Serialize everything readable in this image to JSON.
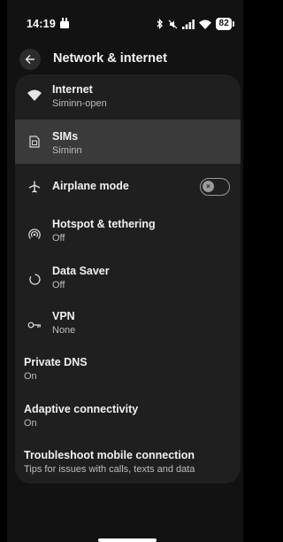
{
  "status_bar": {
    "time": "14:19",
    "battery": "82"
  },
  "header": {
    "title": "Network & internet"
  },
  "items": [
    {
      "title": "Internet",
      "subtitle": "Siminn-open",
      "icon": "wifi-icon"
    },
    {
      "title": "SIMs",
      "subtitle": "Siminn",
      "icon": "sim-card-icon",
      "selected": true
    },
    {
      "title": "Airplane mode",
      "icon": "airplane-icon",
      "toggle": "off"
    },
    {
      "title": "Hotspot & tethering",
      "subtitle": "Off",
      "icon": "hotspot-icon"
    },
    {
      "title": "Data Saver",
      "subtitle": "Off",
      "icon": "data-saver-icon"
    },
    {
      "title": "VPN",
      "subtitle": "None",
      "icon": "vpn-key-icon"
    },
    {
      "title": "Private DNS",
      "subtitle": "On"
    },
    {
      "title": "Adaptive connectivity",
      "subtitle": "On"
    },
    {
      "title": "Troubleshoot mobile connection",
      "subtitle": "Tips for issues with calls, texts and data"
    }
  ],
  "colors": {
    "background": "#121212",
    "card": "#1f1f1f",
    "selected_row": "#3a3a3a"
  }
}
